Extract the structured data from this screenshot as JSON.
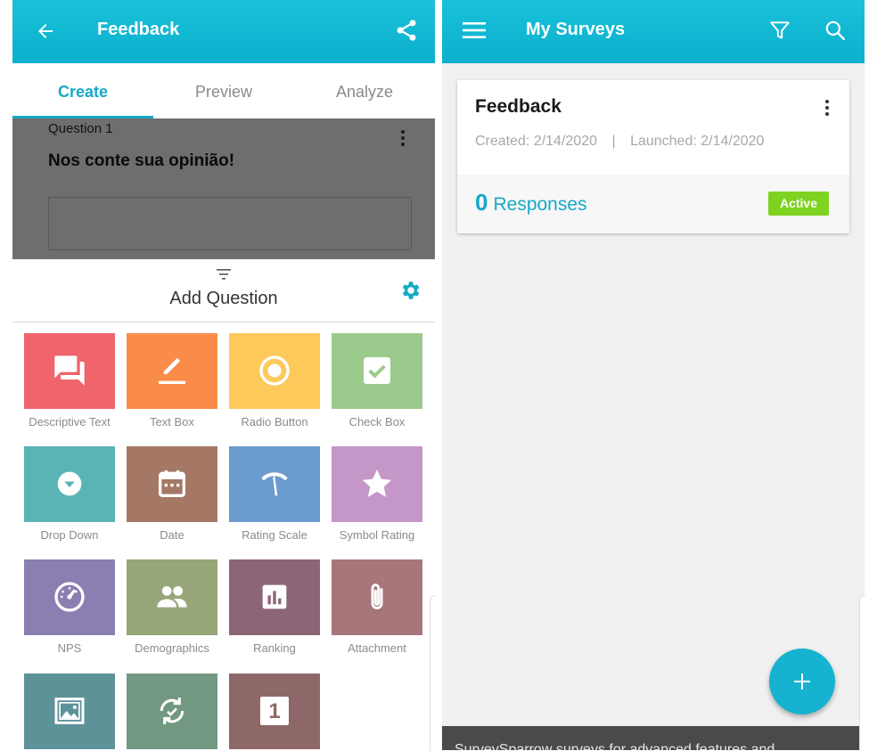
{
  "left": {
    "header": {
      "title": "Feedback",
      "back_icon": "arrow-left-icon",
      "share_icon": "share-icon"
    },
    "tabs": [
      {
        "label": "Create",
        "active": true
      },
      {
        "label": "Preview",
        "active": false
      },
      {
        "label": "Analyze",
        "active": false
      }
    ],
    "question": {
      "number": "Question 1",
      "text": "Nos conte sua opinião!"
    },
    "add_question": {
      "title": "Add Question"
    },
    "tiles": [
      {
        "label": "Descriptive Text",
        "color": "#f0646b",
        "icon": "chat-icon"
      },
      {
        "label": "Text Box",
        "color": "#fa8c4a",
        "icon": "edit-pen-icon"
      },
      {
        "label": "Radio Button",
        "color": "#fcc95a",
        "icon": "radio-button-icon"
      },
      {
        "label": "Check Box",
        "color": "#9bcb8c",
        "icon": "checkbox-icon"
      },
      {
        "label": "Drop Down",
        "color": "#5ab4b4",
        "icon": "dropdown-icon"
      },
      {
        "label": "Date",
        "color": "#a57866",
        "icon": "calendar-icon"
      },
      {
        "label": "Rating Scale",
        "color": "#6a9ccf",
        "icon": "gauge-needle-icon"
      },
      {
        "label": "Symbol Rating",
        "color": "#c596c8",
        "icon": "star-icon"
      },
      {
        "label": "NPS",
        "color": "#8b7eb1",
        "icon": "speedometer-icon"
      },
      {
        "label": "Demographics",
        "color": "#96a678",
        "icon": "people-icon"
      },
      {
        "label": "Ranking",
        "color": "#8c6577",
        "icon": "bar-chart-icon"
      },
      {
        "label": "Attachment",
        "color": "#a6767a",
        "icon": "paperclip-icon"
      },
      {
        "label": "",
        "color": "#5e9299",
        "icon": "image-icon"
      },
      {
        "label": "",
        "color": "#729881",
        "icon": "refresh-icon"
      },
      {
        "label": "",
        "color": "#8e6868",
        "icon": "number-one-icon",
        "glyph": "1"
      }
    ]
  },
  "right": {
    "header": {
      "title": "My Surveys",
      "menu_icon": "hamburger-menu-icon",
      "filter_icon": "filter-icon",
      "search_icon": "search-icon"
    },
    "survey": {
      "title": "Feedback",
      "created": "Created: 2/14/2020",
      "separator": "|",
      "launched": "Launched: 2/14/2020",
      "responses_count": "0",
      "responses_label": "Responses",
      "status": "Active",
      "status_color": "#7ed321"
    },
    "fab_icon": "plus-icon",
    "snackbar_text": "SurveySparrow surveys for advanced features and"
  },
  "colors": {
    "accent": "#15a9c6",
    "header": "#0bb0cc"
  }
}
